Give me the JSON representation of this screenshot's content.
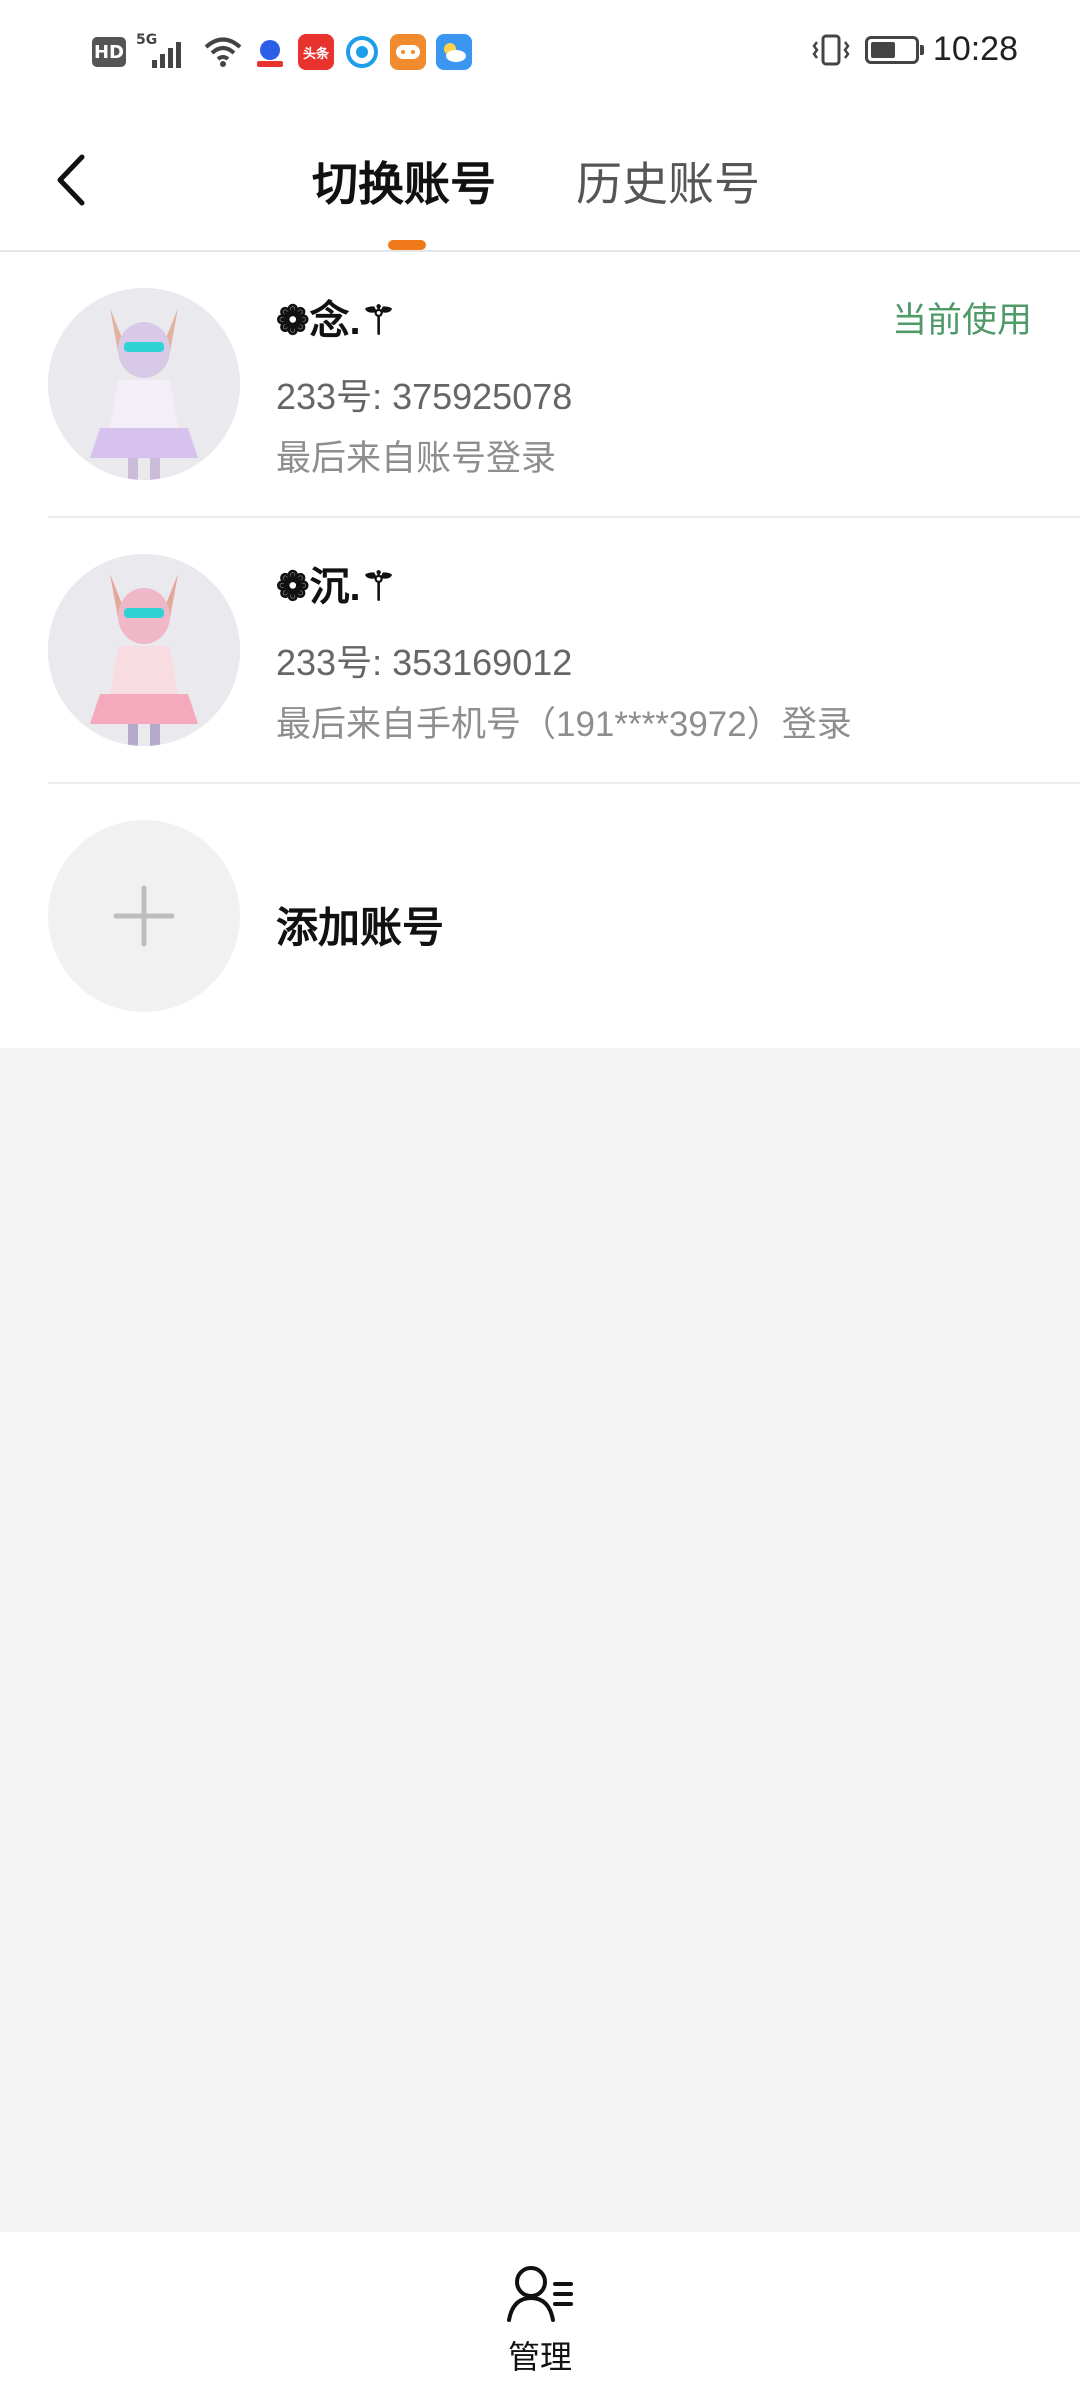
{
  "status_bar": {
    "hd_badge": "HD",
    "network": "5G",
    "app_icons": [
      {
        "name": "baidu-app-icon",
        "color": "#2a5de8"
      },
      {
        "name": "toutiao-app-icon",
        "color": "#e8322e",
        "text": "头条"
      },
      {
        "name": "browser-app-icon",
        "color": "#1e9ee8"
      },
      {
        "name": "game-app-icon",
        "color": "#f28a2e"
      },
      {
        "name": "weather-app-icon",
        "color": "#3a96f0"
      }
    ],
    "time": "10:28"
  },
  "nav": {
    "tabs": [
      {
        "label": "切换账号",
        "active": true
      },
      {
        "label": "历史账号",
        "active": false
      }
    ],
    "accent_color": "#f07a1a"
  },
  "accounts": [
    {
      "name_main": "念.",
      "uid": "233号: 375925078",
      "login_source": "最后来自账号登录",
      "badge": "当前使用"
    },
    {
      "name_main": "沉.",
      "uid": "233号: 353169012",
      "login_source": "最后来自手机号（191****3972）登录",
      "badge": ""
    }
  ],
  "add_account": {
    "label": "添加账号"
  },
  "bottom": {
    "manage_label": "管理"
  }
}
